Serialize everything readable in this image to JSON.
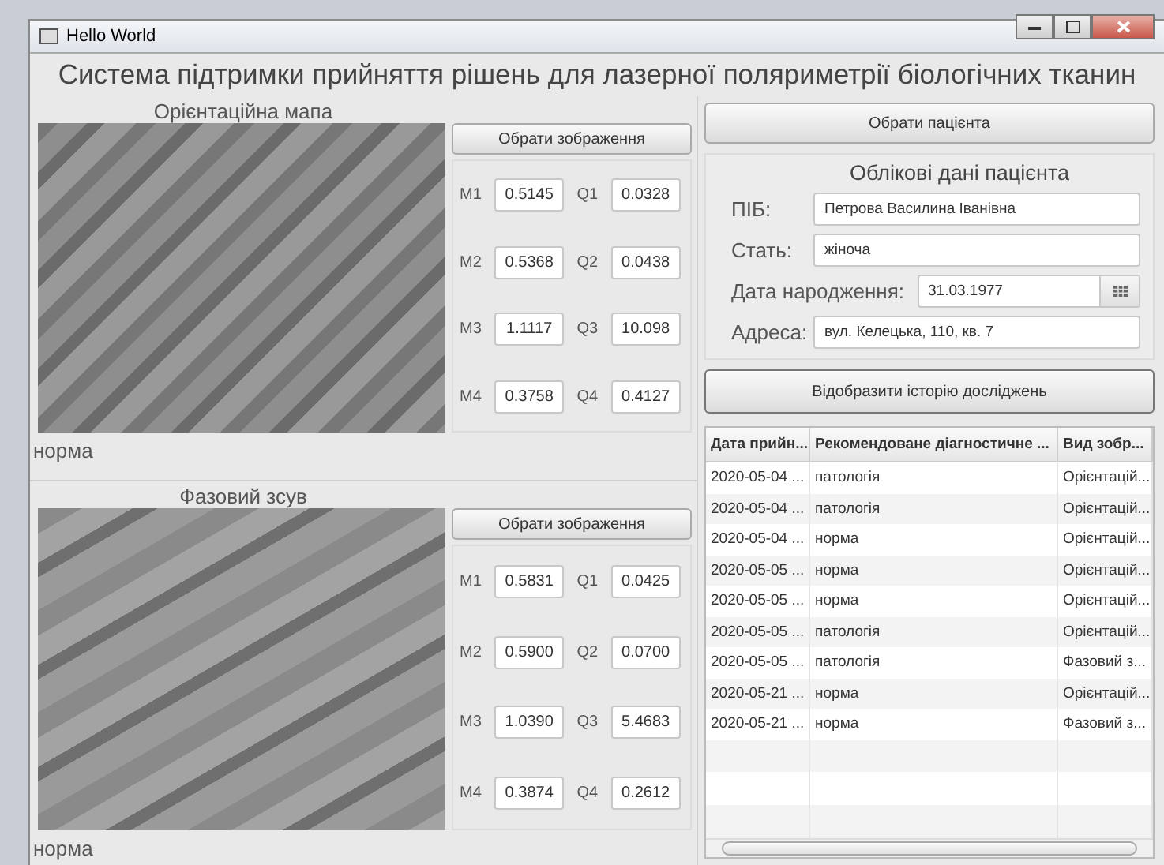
{
  "window": {
    "title": "Hello World"
  },
  "header": "Система підтримки прийняття рішень для лазерної поляриметрії біологічних тканин",
  "panels": [
    {
      "title": "Орієнтаційна мапа",
      "button": "Обрати зображення",
      "measures": [
        {
          "m_label": "M1",
          "m_value": "0.5145",
          "q_label": "Q1",
          "q_value": "0.0328"
        },
        {
          "m_label": "M2",
          "m_value": "0.5368",
          "q_label": "Q2",
          "q_value": "0.0438"
        },
        {
          "m_label": "M3",
          "m_value": "1.1117",
          "q_label": "Q3",
          "q_value": "10.098"
        },
        {
          "m_label": "M4",
          "m_value": "0.3758",
          "q_label": "Q4",
          "q_value": "0.4127"
        }
      ],
      "verdict": "норма"
    },
    {
      "title": "Фазовий зсув",
      "button": "Обрати зображення",
      "measures": [
        {
          "m_label": "M1",
          "m_value": "0.5831",
          "q_label": "Q1",
          "q_value": "0.0425"
        },
        {
          "m_label": "M2",
          "m_value": "0.5900",
          "q_label": "Q2",
          "q_value": "0.0700"
        },
        {
          "m_label": "M3",
          "m_value": "1.0390",
          "q_label": "Q3",
          "q_value": "5.4683"
        },
        {
          "m_label": "M4",
          "m_value": "0.3874",
          "q_label": "Q4",
          "q_value": "0.2612"
        }
      ],
      "verdict": "норма"
    }
  ],
  "patient_button": "Обрати пацієнта",
  "patient_card": {
    "title": "Облікові дані пацієнта",
    "fields": [
      {
        "label": "ПІБ:",
        "value": "Петрова Василина Іванівна",
        "kind": "text"
      },
      {
        "label": "Стать:",
        "value": "жіноча",
        "kind": "text"
      },
      {
        "label": "Дата народження:",
        "value": "31.03.1977",
        "kind": "date"
      },
      {
        "label": "Адреса:",
        "value": "вул. Келецька, 110, кв. 7",
        "kind": "text"
      }
    ]
  },
  "history_button": "Відобразити історію досліджень",
  "table": {
    "columns": [
      "Дата прийн...",
      "Рекомендоване діагностичне ...",
      "Вид зобр..."
    ],
    "rows": [
      [
        "2020-05-04 ...",
        "патологія",
        "Орієнтацій..."
      ],
      [
        "2020-05-04 ...",
        "патологія",
        "Орієнтацій..."
      ],
      [
        "2020-05-04 ...",
        "норма",
        "Орієнтацій..."
      ],
      [
        "2020-05-05 ...",
        "норма",
        "Орієнтацій..."
      ],
      [
        "2020-05-05 ...",
        "норма",
        "Орієнтацій..."
      ],
      [
        "2020-05-05 ...",
        "патологія",
        "Орієнтацій..."
      ],
      [
        "2020-05-05 ...",
        "патологія",
        "Фазовий з..."
      ],
      [
        "2020-05-21 ...",
        "норма",
        "Орієнтацій..."
      ],
      [
        "2020-05-21 ...",
        "норма",
        "Фазовий з..."
      ]
    ]
  }
}
